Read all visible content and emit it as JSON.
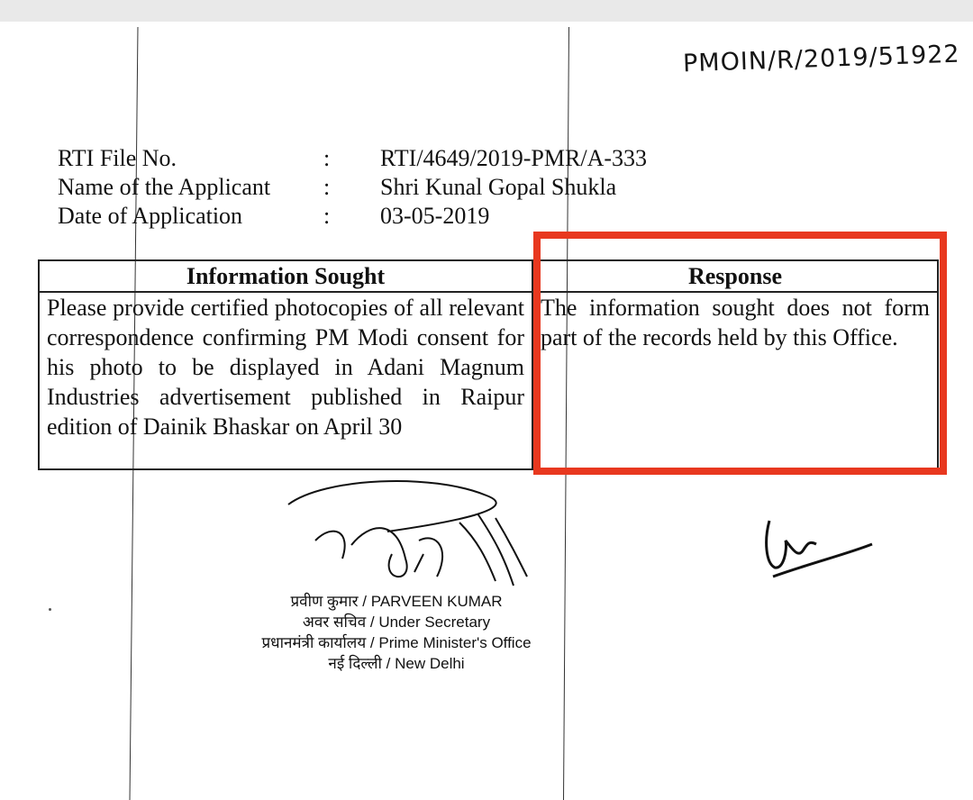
{
  "handwritten_reference": "PMOIN/R/2019/51922",
  "rti_details": [
    {
      "label": "RTI File No.",
      "separator": ":",
      "value": "RTI/4649/2019-PMR/A-333"
    },
    {
      "label": "Name of the Applicant",
      "separator": ":",
      "value": "Shri Kunal Gopal Shukla"
    },
    {
      "label": "Date of Application",
      "separator": ":",
      "value": "03-05-2019"
    }
  ],
  "table": {
    "headers": [
      "Information Sought",
      "Response"
    ],
    "rows": [
      {
        "information_sought": "Please provide certified photocopies of all relevant correspondence confirming PM Modi consent for his photo to be displayed in Adani Magnum Industries advertisement published in Raipur edition of Dainik Bhaskar on April 30",
        "response": "The information sought does not form part of the records held by this Office."
      }
    ]
  },
  "highlight_color": "#e8381f",
  "signatory": {
    "name": "प्रवीण कुमार / PARVEEN KUMAR",
    "designation": "अवर सचिव / Under Secretary",
    "office": "प्रधानमंत्री कार्यालय / Prime Minister's Office",
    "location": "नई दिल्ली / New Delhi"
  }
}
